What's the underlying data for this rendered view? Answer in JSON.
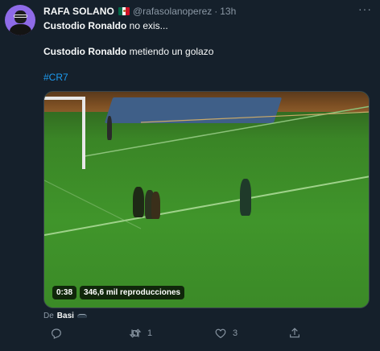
{
  "tweet": {
    "display_name": "RAFA SOLANO",
    "flag": "mexico",
    "handle": "@rafasolanoperez",
    "dot": "·",
    "time": "13h",
    "more": "···",
    "line1_bold": "Custodio Ronaldo",
    "line1_rest": " no exis...",
    "line2_bold": "Custodio Ronaldo",
    "line2_rest": " metiendo un golazo",
    "hashtag": "#CR7"
  },
  "media": {
    "duration": "0:38",
    "views": "346,6 mil reproducciones"
  },
  "via": {
    "prefix": "De",
    "name": "Basi"
  },
  "actions": {
    "reply_count": "",
    "retweet_count": "1",
    "like_count": "3"
  },
  "colors": {
    "background": "#15202b",
    "accent": "#1d9bf0",
    "muted": "#8b98a5",
    "text": "#f7f9f9"
  },
  "icons": [
    "avatar",
    "mexico-flag-icon",
    "more-icon",
    "reply-icon",
    "retweet-icon",
    "like-icon",
    "share-icon"
  ]
}
